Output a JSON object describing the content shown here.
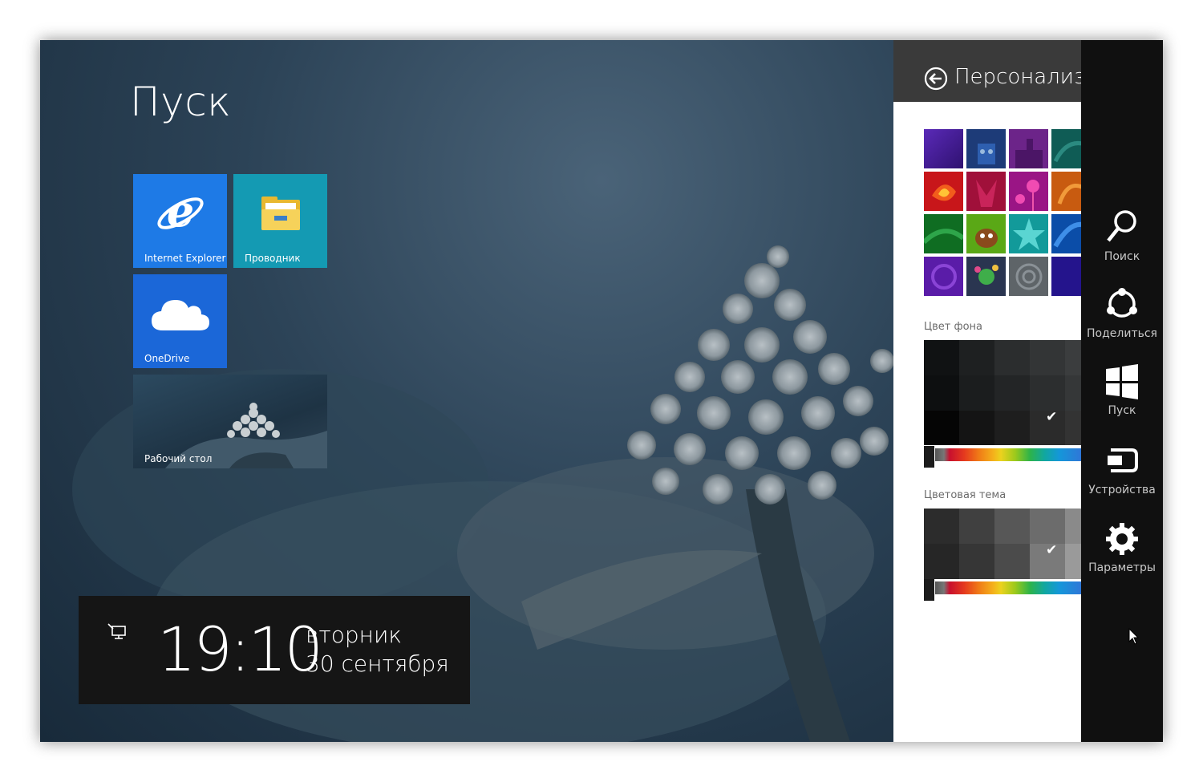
{
  "start": {
    "title": "Пуск",
    "tiles": {
      "ie": "Internet Explorer",
      "explorer": "Проводник",
      "onedrive": "OneDrive",
      "desktop": "Рабочий стол"
    }
  },
  "clock": {
    "time": "19:10",
    "day": "вторник",
    "date": "30 сентября"
  },
  "pane": {
    "title": "Персонализа",
    "background_color_label": "Цвет фона",
    "color_theme_label": "Цветовая тема",
    "background_selected_color": "#2b2b2b",
    "theme_selected_color": "#7a7a7a"
  },
  "charms": {
    "search": "Поиск",
    "share": "Поделиться",
    "start": "Пуск",
    "devices": "Устройства",
    "settings": "Параметры"
  },
  "colors": {
    "ie_tile": "#1e7ae6",
    "explorer_tile": "#149ab3",
    "onedrive_tile": "#1b67d8",
    "charms_bg": "#101010",
    "pane_header": "#3a3a3a"
  }
}
